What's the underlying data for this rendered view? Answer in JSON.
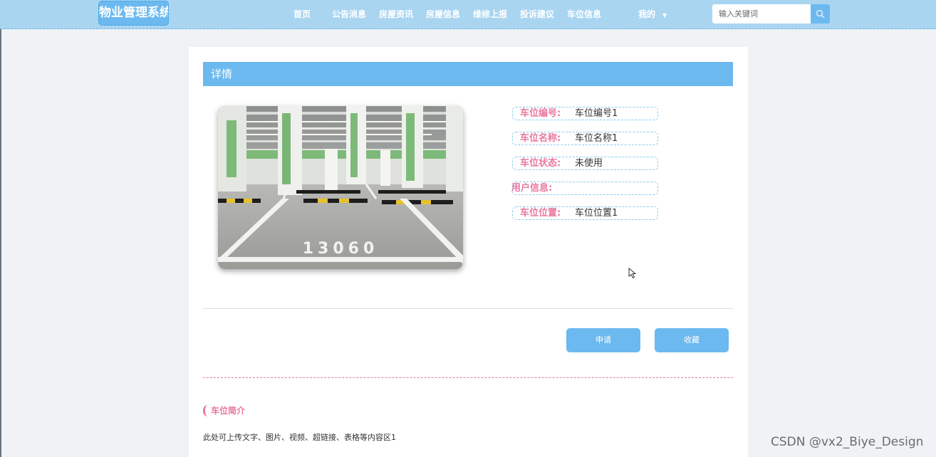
{
  "header": {
    "logo_text": "物业管理系统",
    "nav": [
      {
        "label": "首页"
      },
      {
        "label": "公告消息"
      },
      {
        "label": "房屋资讯"
      },
      {
        "label": "房屋信息"
      },
      {
        "label": "维修上报"
      },
      {
        "label": "投诉建议"
      },
      {
        "label": "车位信息"
      },
      {
        "label": "我的"
      }
    ],
    "search": {
      "placeholder": "输入关键词",
      "value": ""
    }
  },
  "detail": {
    "section_title": "详情",
    "photo": {
      "subject": "underground parking lot",
      "floor_number": "13060"
    },
    "fields": [
      {
        "label": "车位编号:",
        "value": "车位编号1"
      },
      {
        "label": "车位名称:",
        "value": "车位名称1"
      },
      {
        "label": "车位状态:",
        "value": "未使用"
      },
      {
        "label": "用户信息:",
        "value": ""
      },
      {
        "label": "车位位置:",
        "value": "车位位置1"
      }
    ],
    "buttons": {
      "apply": "申请",
      "favorite": "收藏"
    }
  },
  "intro": {
    "title": "车位简介",
    "text": "此处可上传文字、图片、视频、超链接、表格等内容区1"
  },
  "watermark": "CSDN @vx2_Biye_Design",
  "colors": {
    "header_bg": "#a9d5f1",
    "accent_blue": "#6cb9ef",
    "accent_pink": "#e8789f",
    "page_bg": "#f0f2f5"
  },
  "icons": {
    "search": "search-icon",
    "dropdown": "chevron-down-icon"
  }
}
